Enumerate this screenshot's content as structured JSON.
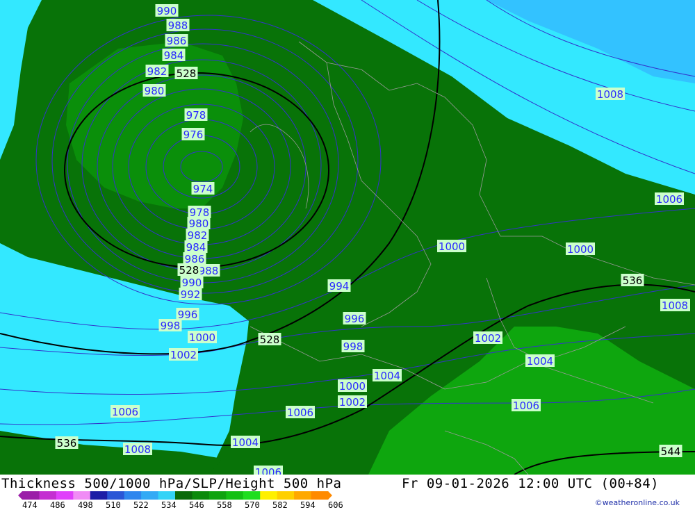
{
  "title": "Thickness 500/1000 hPa/SLP/Height 500 hPa",
  "datetime": "Fr 09-01-2026 12:00 UTC (00+84)",
  "credit": "©weatheronline.co.uk",
  "legend": {
    "ticks": [
      "474",
      "486",
      "498",
      "510",
      "522",
      "534",
      "546",
      "558",
      "570",
      "582",
      "594",
      "606"
    ],
    "colors": [
      "#9b1fa8",
      "#c42fd1",
      "#e040fb",
      "#f08cf5",
      "#1d1da6",
      "#2a56d6",
      "#2f86ee",
      "#33aaf5",
      "#33d3f7",
      "#0a6a0a",
      "#0b8a0b",
      "#0fa30f",
      "#13c013",
      "#1ede1e",
      "#fff000",
      "#ffd000",
      "#ffa800",
      "#ff8a00"
    ]
  },
  "isobar_labels": [
    {
      "text": "990",
      "color": "#2a2aff"
    },
    {
      "text": "988",
      "color": "#2a2aff"
    },
    {
      "text": "986",
      "color": "#2a2aff"
    },
    {
      "text": "984",
      "color": "#2a2aff"
    },
    {
      "text": "982",
      "color": "#2a2aff"
    },
    {
      "text": "980",
      "color": "#2a2aff"
    },
    {
      "text": "978",
      "color": "#2a2aff"
    },
    {
      "text": "976",
      "color": "#2a2aff"
    },
    {
      "text": "974",
      "color": "#2a2aff"
    },
    {
      "text": "978",
      "color": "#2a2aff"
    },
    {
      "text": "980",
      "color": "#2a2aff"
    },
    {
      "text": "982",
      "color": "#2a2aff"
    },
    {
      "text": "984",
      "color": "#2a2aff"
    },
    {
      "text": "986",
      "color": "#2a2aff"
    },
    {
      "text": "988",
      "color": "#2a2aff"
    },
    {
      "text": "990",
      "color": "#2a2aff"
    },
    {
      "text": "992",
      "color": "#2a2aff"
    },
    {
      "text": "996",
      "color": "#2a2aff"
    },
    {
      "text": "998",
      "color": "#2a2aff"
    },
    {
      "text": "1000",
      "color": "#2a2aff"
    },
    {
      "text": "1002",
      "color": "#2a2aff"
    },
    {
      "text": "994",
      "color": "#2a2aff"
    },
    {
      "text": "996",
      "color": "#2a2aff"
    },
    {
      "text": "998",
      "color": "#2a2aff"
    },
    {
      "text": "1000",
      "color": "#2a2aff"
    },
    {
      "text": "1004",
      "color": "#2a2aff"
    },
    {
      "text": "1000",
      "color": "#2a2aff"
    },
    {
      "text": "1002",
      "color": "#2a2aff"
    },
    {
      "text": "1006",
      "color": "#2a2aff"
    },
    {
      "text": "1004",
      "color": "#2a2aff"
    },
    {
      "text": "1006",
      "color": "#2a2aff"
    },
    {
      "text": "1008",
      "color": "#2a2aff"
    },
    {
      "text": "1006",
      "color": "#2a2aff"
    },
    {
      "text": "1008",
      "color": "#2a2aff"
    },
    {
      "text": "1006",
      "color": "#2a2aff"
    },
    {
      "text": "1000",
      "color": "#2a2aff"
    },
    {
      "text": "1004",
      "color": "#2a2aff"
    },
    {
      "text": "1002",
      "color": "#2a2aff"
    },
    {
      "text": "1004",
      "color": "#2a2aff"
    },
    {
      "text": "1006",
      "color": "#2a2aff"
    },
    {
      "text": "1008",
      "color": "#2a2aff"
    },
    {
      "text": "1006",
      "color": "#2a2aff"
    }
  ],
  "height_labels": [
    {
      "text": "528"
    },
    {
      "text": "528"
    },
    {
      "text": "528"
    },
    {
      "text": "536"
    },
    {
      "text": "536"
    },
    {
      "text": "544"
    }
  ],
  "colors": {
    "cyan_thickness": "#33e8ff",
    "light_blue_thickness": "#33c2ff",
    "dark_green_thickness": "#087308",
    "mid_green_thickness": "#0a8f0a",
    "light_green_thickness": "#0ea60e",
    "isobar": "#3333cc",
    "height_contour": "#000000",
    "label_bg": "#ccffcc"
  }
}
